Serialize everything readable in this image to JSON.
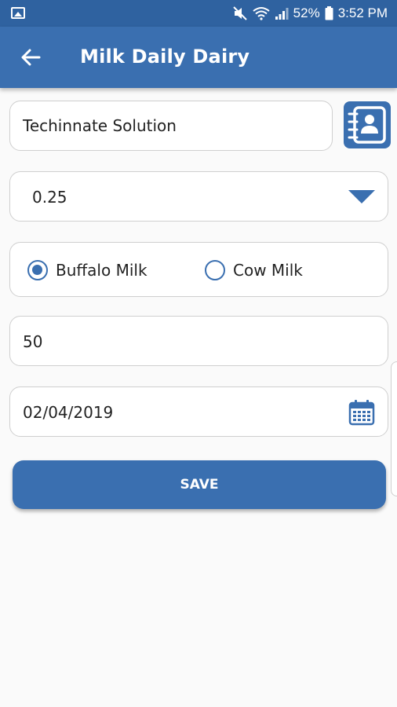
{
  "status_bar": {
    "battery": "52%",
    "time": "3:52 PM",
    "icons": [
      "image-icon",
      "mute-icon",
      "wifi-icon",
      "signal-icon",
      "battery-icon"
    ]
  },
  "app_bar": {
    "title": "Milk Daily Dairy",
    "back_icon": "arrow-left-icon"
  },
  "form": {
    "customer_name": "Techinnate Solution",
    "contact_icon": "contact-book-icon",
    "quantity": "0.25",
    "milk_type": {
      "options": [
        "Buffalo Milk",
        "Cow Milk"
      ],
      "selected": "Buffalo Milk"
    },
    "amount": "50",
    "date": "02/04/2019",
    "calendar_icon": "calendar-icon"
  },
  "actions": {
    "save_label": "SAVE"
  },
  "colors": {
    "primary": "#3a6fb0",
    "status_bar": "#2f62a0",
    "background": "#fafafa",
    "field_border": "#cfcfcf"
  }
}
